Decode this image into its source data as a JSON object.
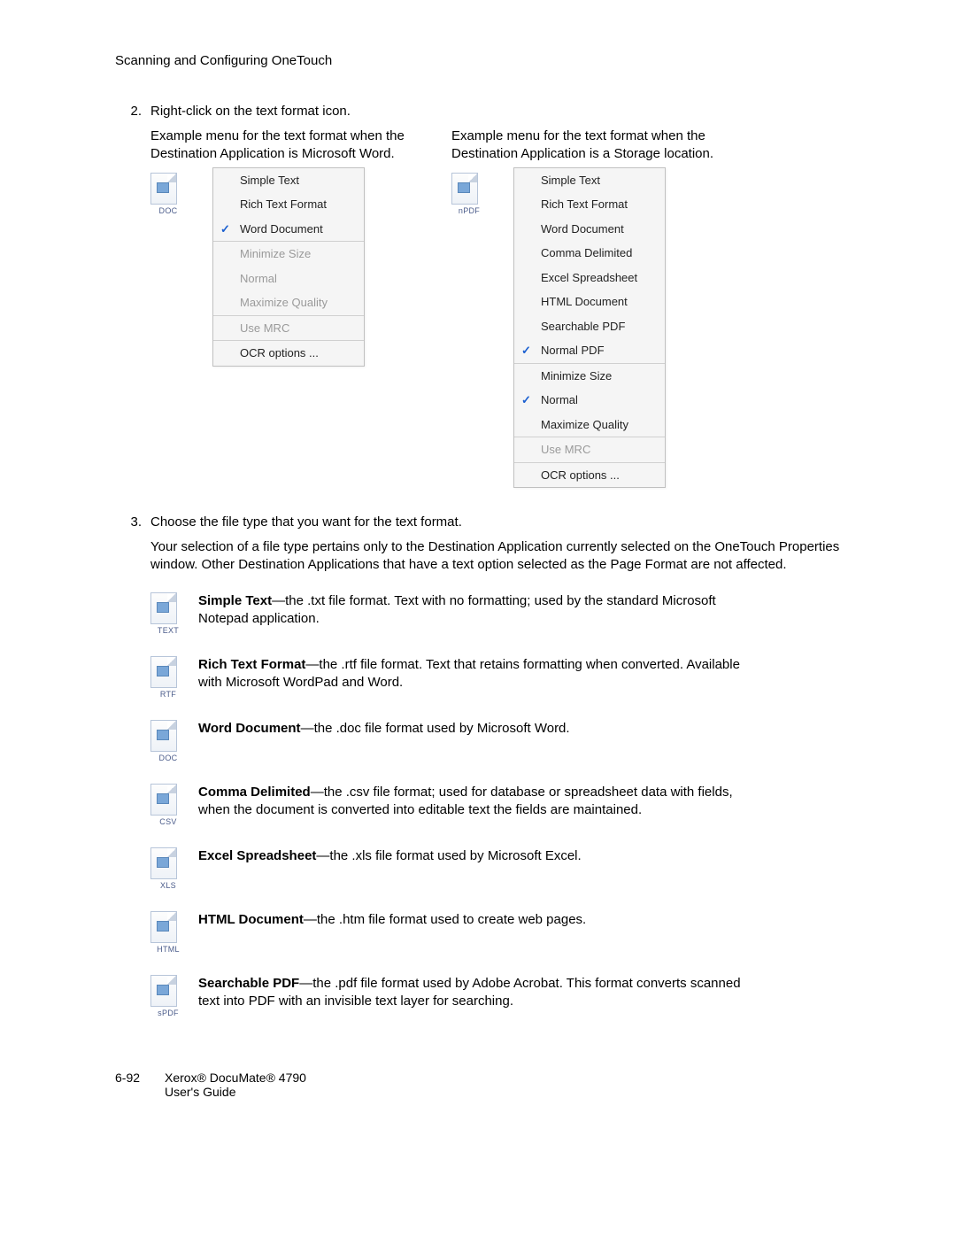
{
  "header": "Scanning and Configuring OneTouch",
  "step2": {
    "num": "2.",
    "text": "Right-click on the text format icon."
  },
  "example_left": {
    "caption": "Example menu for the text format when the Destination Application is Microsoft Word.",
    "icon_label": "DOC",
    "menu": [
      {
        "label": "Simple Text",
        "checked": false,
        "disabled": false
      },
      {
        "label": "Rich Text Format",
        "checked": false,
        "disabled": false
      },
      {
        "label": "Word Document",
        "checked": true,
        "disabled": false
      }
    ],
    "menu2": [
      {
        "label": "Minimize Size",
        "checked": false,
        "disabled": true
      },
      {
        "label": "Normal",
        "checked": false,
        "disabled": true
      },
      {
        "label": "Maximize Quality",
        "checked": false,
        "disabled": true
      }
    ],
    "menu3": [
      {
        "label": "Use MRC",
        "checked": false,
        "disabled": true
      }
    ],
    "menu4": [
      {
        "label": "OCR options ...",
        "checked": false,
        "disabled": false
      }
    ]
  },
  "example_right": {
    "caption": "Example menu for the text format when the Destination Application is a Storage location.",
    "icon_label": "nPDF",
    "menu": [
      {
        "label": "Simple Text",
        "checked": false,
        "disabled": false
      },
      {
        "label": "Rich Text Format",
        "checked": false,
        "disabled": false
      },
      {
        "label": "Word Document",
        "checked": false,
        "disabled": false
      },
      {
        "label": "Comma Delimited",
        "checked": false,
        "disabled": false
      },
      {
        "label": "Excel Spreadsheet",
        "checked": false,
        "disabled": false
      },
      {
        "label": "HTML Document",
        "checked": false,
        "disabled": false
      },
      {
        "label": "Searchable PDF",
        "checked": false,
        "disabled": false
      },
      {
        "label": "Normal PDF",
        "checked": true,
        "disabled": false
      }
    ],
    "menu2": [
      {
        "label": "Minimize Size",
        "checked": false,
        "disabled": false
      },
      {
        "label": "Normal",
        "checked": true,
        "disabled": false
      },
      {
        "label": "Maximize Quality",
        "checked": false,
        "disabled": false
      }
    ],
    "menu3": [
      {
        "label": "Use MRC",
        "checked": false,
        "disabled": true
      }
    ],
    "menu4": [
      {
        "label": "OCR options ...",
        "checked": false,
        "disabled": false
      }
    ]
  },
  "step3": {
    "num": "3.",
    "text": "Choose the file type that you want for the text format.",
    "body": "Your selection of a file type pertains only to the Destination Application currently selected on the OneTouch Properties window. Other Destination Applications that have a text option selected as the Page Format are not affected."
  },
  "formats": [
    {
      "icon": "TEXT",
      "bold": "Simple Text",
      "rest": "—the .txt file format. Text with no formatting; used by the standard Microsoft Notepad application."
    },
    {
      "icon": "RTF",
      "bold": "Rich Text Format",
      "rest": "—the .rtf file format. Text that retains formatting when converted. Available with Microsoft WordPad and Word."
    },
    {
      "icon": "DOC",
      "bold": "Word Document",
      "rest": "—the .doc file format used by Microsoft Word."
    },
    {
      "icon": "CSV",
      "bold": "Comma Delimited",
      "rest": "—the .csv file format; used for database or spreadsheet data with fields, when the document is converted into editable text the fields are maintained."
    },
    {
      "icon": "XLS",
      "bold": "Excel Spreadsheet",
      "rest": "—the .xls file format used by Microsoft Excel."
    },
    {
      "icon": "HTML",
      "bold": "HTML Document",
      "rest": "—the .htm file format used to create web pages."
    },
    {
      "icon": "sPDF",
      "bold": "Searchable PDF",
      "rest": "—the .pdf file format used by Adobe Acrobat. This format converts scanned text into PDF with an invisible text layer for searching."
    }
  ],
  "footer": {
    "pagenum": "6-92",
    "line1": "Xerox® DocuMate® 4790",
    "line2": "User's Guide"
  }
}
